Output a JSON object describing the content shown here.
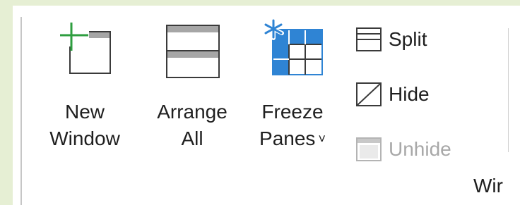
{
  "ribbon_group": {
    "label": "Wir",
    "buttons": {
      "new_window": {
        "line1": "New",
        "line2": "Window"
      },
      "arrange_all": {
        "line1": "Arrange",
        "line2": "All"
      },
      "freeze_panes": {
        "line1": "Freeze",
        "line2": "Panes",
        "dropdown_glyph": "˅"
      },
      "split": {
        "label": "Split"
      },
      "hide": {
        "label": "Hide"
      },
      "unhide": {
        "label": "Unhide",
        "disabled": true
      }
    }
  },
  "colors": {
    "background": "#e6efd4",
    "accent_green": "#2e9e3f",
    "accent_blue": "#2f84d4",
    "icon_gray": "#a6a6a6",
    "text": "#1f1f1f",
    "disabled_text": "#a8a8a8"
  },
  "icons": {
    "new_window": "new-window-icon",
    "arrange_all": "arrange-all-icon",
    "freeze_panes": "freeze-panes-icon",
    "split": "split-icon",
    "hide": "hide-icon",
    "unhide": "unhide-icon"
  }
}
